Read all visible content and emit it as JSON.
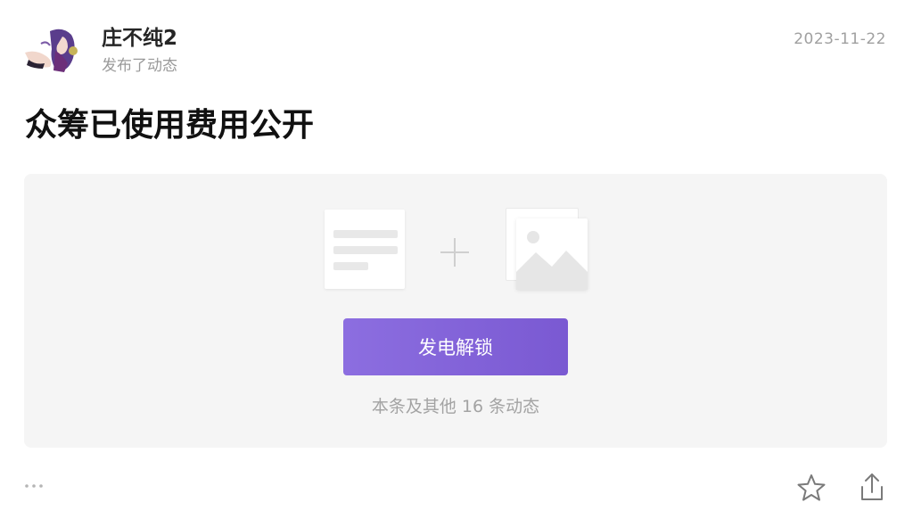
{
  "post": {
    "author_name": "庄不纯2",
    "author_action": "发布了动态",
    "date": "2023-11-22",
    "title": "众筹已使用费用公开"
  },
  "locked": {
    "unlock_button_label": "发电解锁",
    "note": "本条及其他 16 条动态"
  },
  "icons": {
    "avatar": "avatar-anime-character",
    "document": "document-icon",
    "plus": "plus-icon",
    "image": "image-icon",
    "more": "more-dots-icon",
    "star": "star-icon",
    "share": "share-icon"
  },
  "colors": {
    "accent_start": "#8c6ee0",
    "accent_end": "#7a59d2",
    "card_background": "#f5f5f5"
  }
}
